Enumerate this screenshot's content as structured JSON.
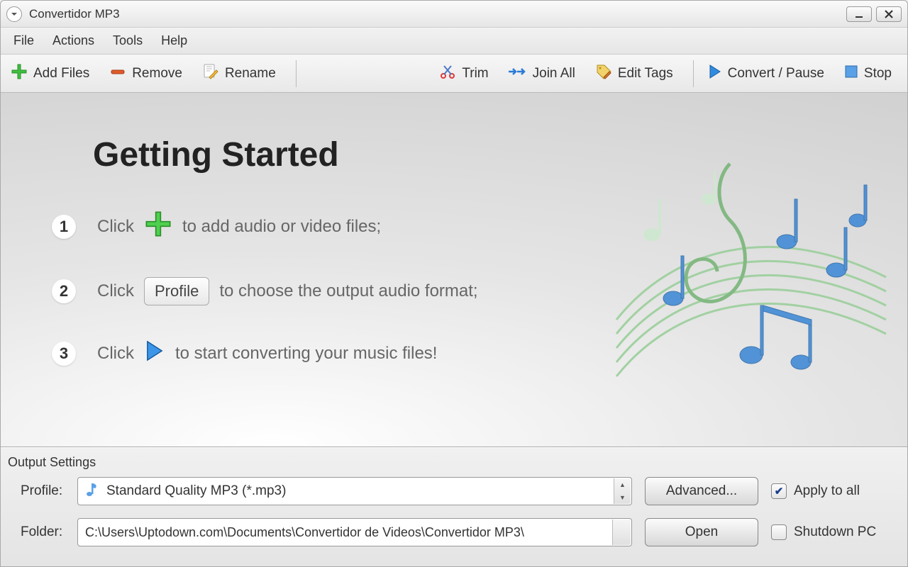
{
  "window": {
    "title": "Convertidor MP3"
  },
  "menu": {
    "items": [
      "File",
      "Actions",
      "Tools",
      "Help"
    ]
  },
  "toolbar": {
    "add": "Add Files",
    "remove": "Remove",
    "rename": "Rename",
    "trim": "Trim",
    "joinall": "Join All",
    "edittags": "Edit Tags",
    "convert": "Convert / Pause",
    "stop": "Stop"
  },
  "main": {
    "heading": "Getting Started",
    "steps": {
      "n1": "1",
      "n2": "2",
      "n3": "3",
      "s1a": "Click",
      "s1b": "to add audio or video files;",
      "s2a": "Click",
      "s2btn": "Profile",
      "s2b": "to choose the output audio format;",
      "s3a": "Click",
      "s3b": "to start converting your music files!"
    }
  },
  "output": {
    "group": "Output Settings",
    "profile_label": "Profile:",
    "profile_value": "Standard Quality MP3 (*.mp3)",
    "folder_label": "Folder:",
    "folder_value": "C:\\Users\\Uptodown.com\\Documents\\Convertidor de Videos\\Convertidor MP3\\",
    "advanced": "Advanced...",
    "open": "Open",
    "apply_all": "Apply to all",
    "shutdown": "Shutdown PC"
  }
}
